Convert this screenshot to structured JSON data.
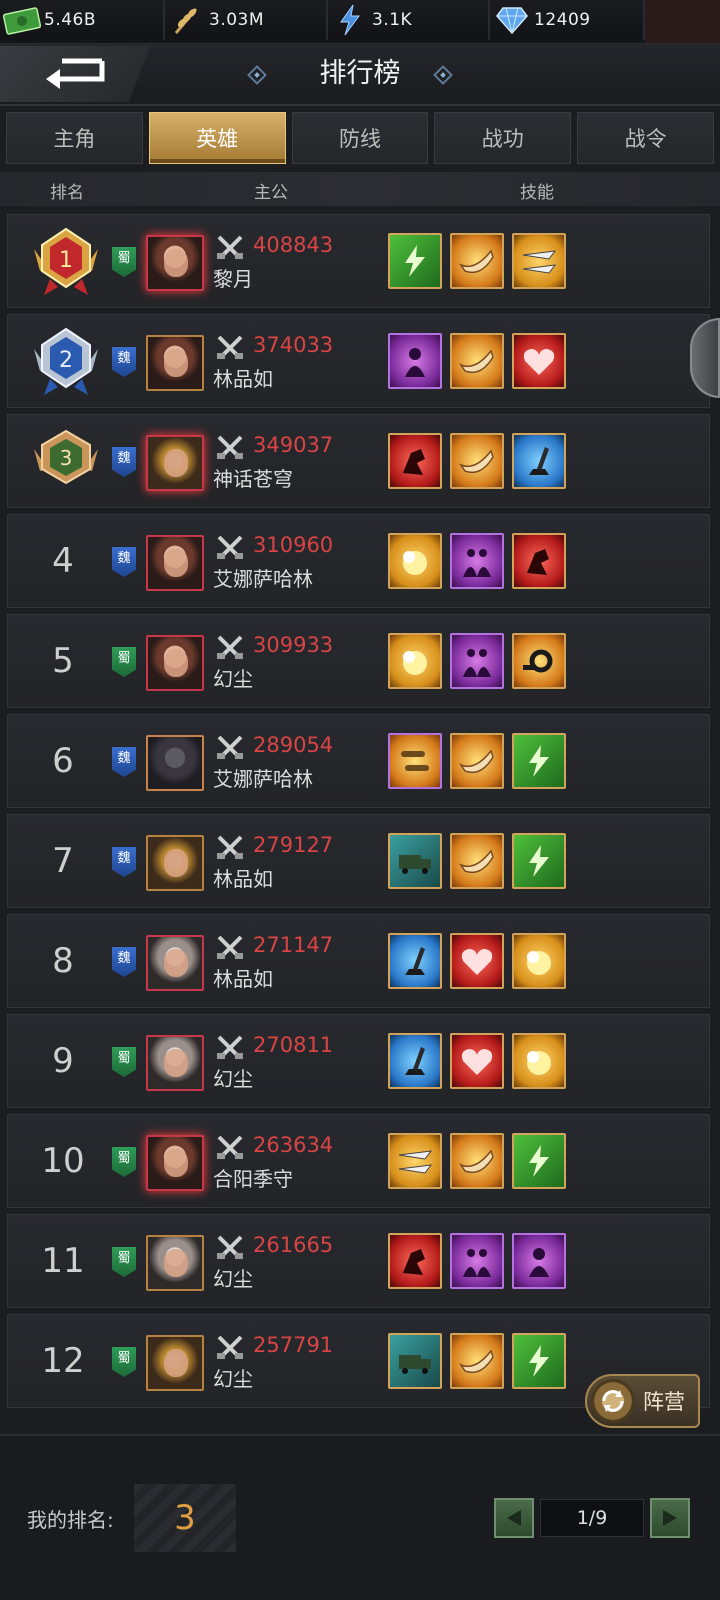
{
  "resources": [
    {
      "icon": "cash-icon",
      "value": "5.46B"
    },
    {
      "icon": "wheat-icon",
      "value": "3.03M"
    },
    {
      "icon": "energy-icon",
      "value": "3.1K"
    },
    {
      "icon": "diamond-icon",
      "value": "12409"
    }
  ],
  "header": {
    "title": "排行榜"
  },
  "tabs": [
    {
      "label": "主角",
      "active": false
    },
    {
      "label": "英雄",
      "active": true
    },
    {
      "label": "防线",
      "active": false
    },
    {
      "label": "战功",
      "active": false
    },
    {
      "label": "战令",
      "active": false
    }
  ],
  "columns": {
    "rank": "排名",
    "lord": "主公",
    "skills": "技能"
  },
  "rows": [
    {
      "rank": "1",
      "faction": "蜀",
      "power": "408843",
      "name": "黎月"
    },
    {
      "rank": "2",
      "faction": "魏",
      "power": "374033",
      "name": "林品如"
    },
    {
      "rank": "3",
      "faction": "魏",
      "power": "349037",
      "name": "神话苍穹"
    },
    {
      "rank": "4",
      "faction": "魏",
      "power": "310960",
      "name": "艾娜萨哈林"
    },
    {
      "rank": "5",
      "faction": "蜀",
      "power": "309933",
      "name": "幻尘"
    },
    {
      "rank": "6",
      "faction": "魏",
      "power": "289054",
      "name": "艾娜萨哈林"
    },
    {
      "rank": "7",
      "faction": "魏",
      "power": "279127",
      "name": "林品如"
    },
    {
      "rank": "8",
      "faction": "魏",
      "power": "271147",
      "name": "林品如"
    },
    {
      "rank": "9",
      "faction": "蜀",
      "power": "270811",
      "name": "幻尘"
    },
    {
      "rank": "10",
      "faction": "蜀",
      "power": "263634",
      "name": "合阳季守"
    },
    {
      "rank": "11",
      "faction": "蜀",
      "power": "261665",
      "name": "幻尘"
    },
    {
      "rank": "12",
      "faction": "蜀",
      "power": "257791",
      "name": "幻尘"
    }
  ],
  "camp_button": {
    "label": "阵营"
  },
  "footer": {
    "my_rank_label": "我的排名:",
    "my_rank_value": "3",
    "page": "1/9"
  },
  "colors": {
    "accent_gold": "#d8b06a",
    "power_red": "#d94444",
    "shu_green": "#2f9e58",
    "wei_blue": "#3a6fcf"
  }
}
